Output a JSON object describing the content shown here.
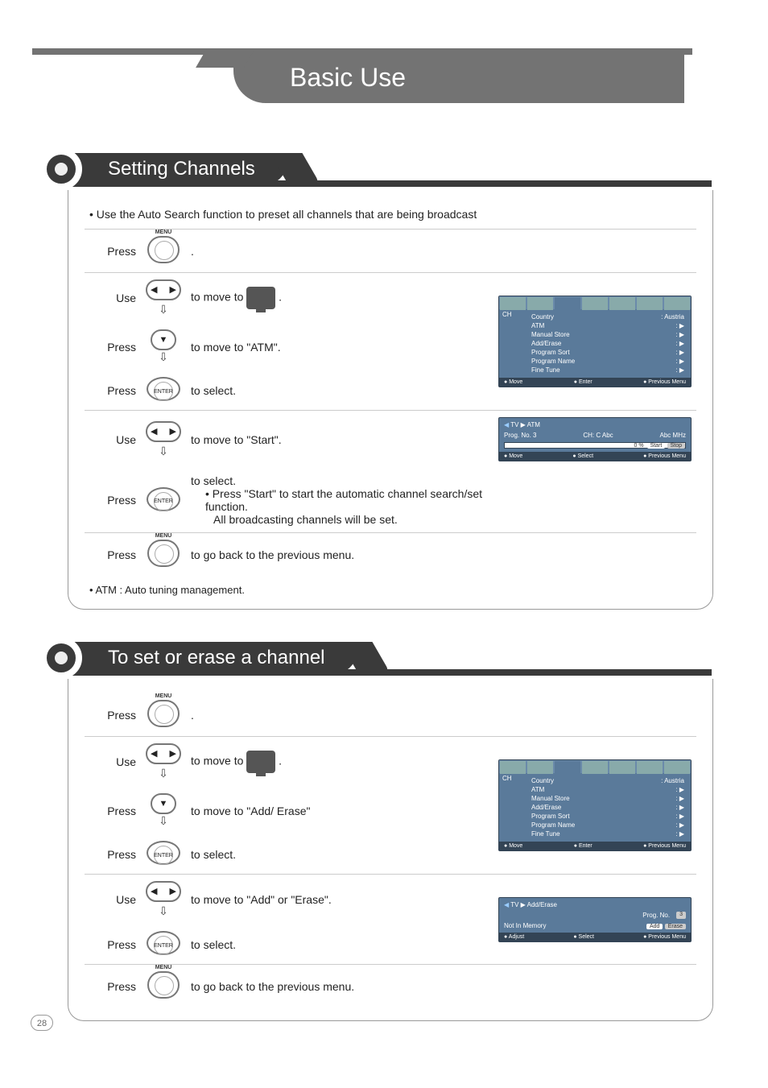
{
  "banner": {
    "title": "Basic Use"
  },
  "page_number": "28",
  "section1": {
    "title": "Setting Channels",
    "intro": "Use the Auto Search function to preset all channels that are being broadcast",
    "footnote": "ATM : Auto tuning management.",
    "steps": [
      {
        "act": "Press",
        "button": "menu",
        "label": "MENU",
        "desc": "."
      },
      {
        "act": "Use",
        "button": "lr",
        "desc_pre": "to move to",
        "desc_post": "."
      },
      {
        "act": "Press",
        "button": "down",
        "desc": "to move to \"ATM\"."
      },
      {
        "act": "Press",
        "button": "enter",
        "label": "ENTER",
        "desc": "to select."
      },
      {
        "act": "Use",
        "button": "lr",
        "desc": "to move to \"Start\"."
      },
      {
        "act": "Press",
        "button": "enter",
        "label": "ENTER",
        "desc": "to select.",
        "sub1": "Press \"Start\" to start the automatic channel search/set function.",
        "sub2": "All broadcasting channels will be set."
      },
      {
        "act": "Press",
        "button": "menu",
        "label": "MENU",
        "desc": "to go back to the previous menu."
      }
    ],
    "osd1": {
      "corner": "CH",
      "items": [
        [
          "Country",
          ": Austria"
        ],
        [
          "ATM",
          ": ▶"
        ],
        [
          "Manual Store",
          ": ▶"
        ],
        [
          "Add/Erase",
          ": ▶"
        ],
        [
          "Program Sort",
          ": ▶"
        ],
        [
          "Program Name",
          ": ▶"
        ],
        [
          "Fine Tune",
          ": ▶"
        ]
      ],
      "foot": [
        "Move",
        "Enter",
        "Previous Menu"
      ]
    },
    "osd2": {
      "crumb": "TV ▶ ATM",
      "row": {
        "progno_l": "Prog. No.",
        "progno_v": "3",
        "ch_l": "CH:",
        "ch_v": "C  Abc",
        "freq_l": "Abc",
        "freq_u": "MHz"
      },
      "pct": "0 %",
      "btns": [
        "Start",
        "Stop"
      ],
      "foot": [
        "Move",
        "Select",
        "Previous Menu"
      ]
    }
  },
  "section2": {
    "title": "To set or erase a channel",
    "steps": [
      {
        "act": "Press",
        "button": "menu",
        "label": "MENU",
        "desc": "."
      },
      {
        "act": "Use",
        "button": "lr",
        "desc_pre": "to move to",
        "desc_post": "."
      },
      {
        "act": "Press",
        "button": "down",
        "desc": "to move to \"Add/ Erase\""
      },
      {
        "act": "Press",
        "button": "enter",
        "label": "ENTER",
        "desc": "to select."
      },
      {
        "act": "Use",
        "button": "lr",
        "desc": "to move to  \"Add\" or \"Erase\"."
      },
      {
        "act": "Press",
        "button": "enter",
        "label": "ENTER",
        "desc": "to select."
      },
      {
        "act": "Press",
        "button": "menu",
        "label": "MENU",
        "desc": "to go back to the previous menu."
      }
    ],
    "osd1": {
      "corner": "CH",
      "items": [
        [
          "Country",
          ": Austria"
        ],
        [
          "ATM",
          ": ▶"
        ],
        [
          "Manual Store",
          ": ▶"
        ],
        [
          "Add/Erase",
          ": ▶"
        ],
        [
          "Program Sort",
          ": ▶"
        ],
        [
          "Program Name",
          ": ▶"
        ],
        [
          "Fine Tune",
          ": ▶"
        ]
      ],
      "foot": [
        "Move",
        "Enter",
        "Previous Menu"
      ]
    },
    "osd2": {
      "crumb": "TV ▶ Add/Erase",
      "row": {
        "progno_l": "Prog. No.",
        "progno_v": "3"
      },
      "mem": "Not In Memory",
      "btns": [
        "Add",
        "Erase"
      ],
      "foot": [
        "Adjust",
        "Select",
        "Previous Menu"
      ]
    }
  }
}
